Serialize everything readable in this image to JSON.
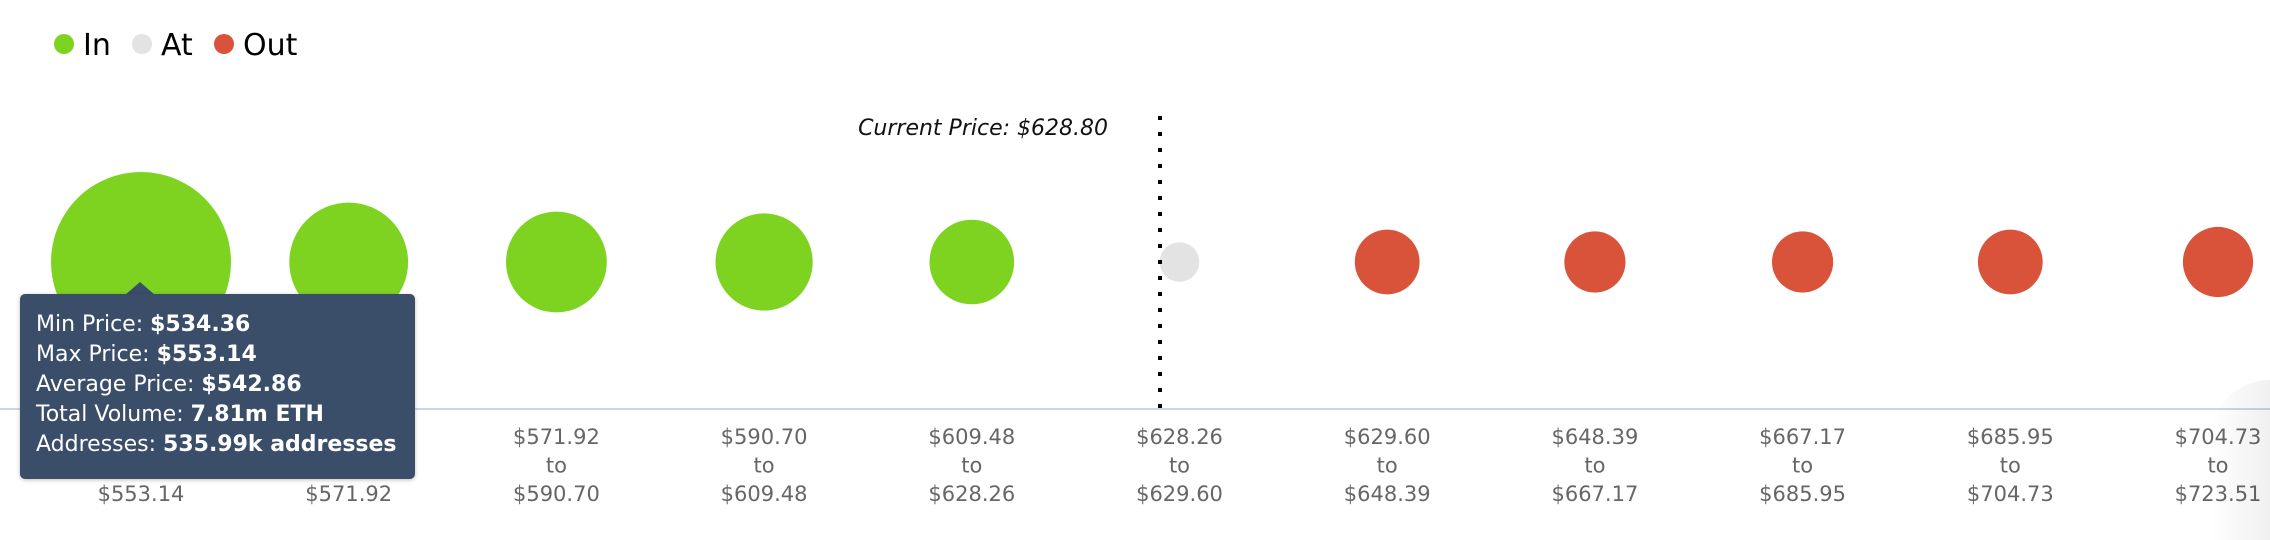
{
  "chart_data": {
    "type": "scatter",
    "subtype": "bubble",
    "title": "",
    "legend": {
      "placement": "top-left",
      "entries": [
        {
          "name": "In",
          "color": "#7ed321"
        },
        {
          "name": "At",
          "color": "#e3e3e3"
        },
        {
          "name": "Out",
          "color": "#d9533a"
        }
      ]
    },
    "annotation": {
      "label": "Current Price: $628.80",
      "value": 628.8
    },
    "categories": [
      {
        "from": "$534.36",
        "to": "$553.14",
        "status": "In",
        "relative_size": 1.0
      },
      {
        "from": "$553.14",
        "to": "$571.92",
        "status": "In",
        "relative_size": 0.66
      },
      {
        "from": "$571.92",
        "to": "$590.70",
        "status": "In",
        "relative_size": 0.56
      },
      {
        "from": "$590.70",
        "to": "$609.48",
        "status": "In",
        "relative_size": 0.54
      },
      {
        "from": "$609.48",
        "to": "$628.26",
        "status": "In",
        "relative_size": 0.47
      },
      {
        "from": "$628.26",
        "to": "$629.60",
        "status": "At",
        "relative_size": 0.22
      },
      {
        "from": "$629.60",
        "to": "$648.39",
        "status": "Out",
        "relative_size": 0.36
      },
      {
        "from": "$648.39",
        "to": "$667.17",
        "status": "Out",
        "relative_size": 0.34
      },
      {
        "from": "$667.17",
        "to": "$685.95",
        "status": "Out",
        "relative_size": 0.34
      },
      {
        "from": "$685.95",
        "to": "$704.73",
        "status": "Out",
        "relative_size": 0.36
      },
      {
        "from": "$704.73",
        "to": "$723.51",
        "status": "Out",
        "relative_size": 0.39
      }
    ],
    "range_joiner": "to",
    "current_price_index_position": 4.9,
    "xlabel": "",
    "ylabel": "",
    "grid": false
  },
  "tooltip": {
    "rows": [
      {
        "label": "Min Price: ",
        "value": "$534.36"
      },
      {
        "label": "Max Price: ",
        "value": "$553.14"
      },
      {
        "label": "Average Price: ",
        "value": "$542.86"
      },
      {
        "label": "Total Volume: ",
        "value": "7.81m ETH"
      },
      {
        "label": "Addresses: ",
        "value": "535.99k addresses"
      }
    ]
  }
}
